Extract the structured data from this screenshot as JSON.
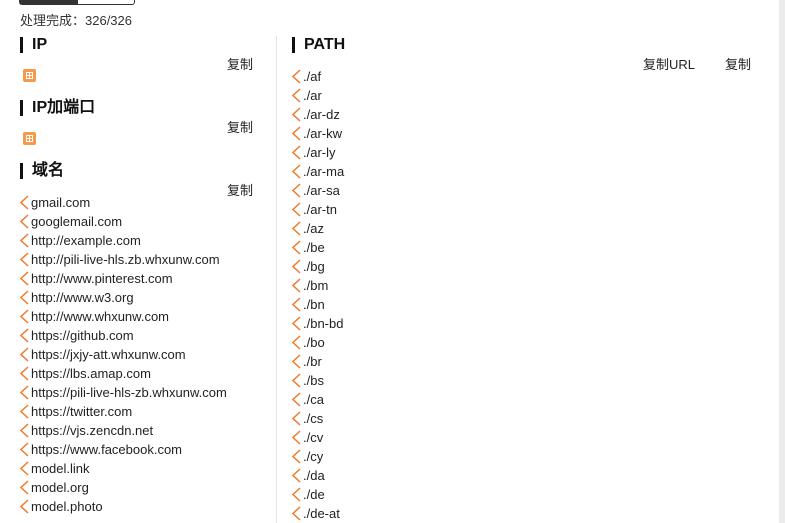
{
  "status": {
    "text": "处理完成：326/326"
  },
  "sections": {
    "ip": {
      "title": "IP",
      "copy_label": "复制"
    },
    "ip_port": {
      "title": "IP加端口",
      "copy_label": "复制"
    },
    "domain": {
      "title": "域名",
      "copy_label": "复制",
      "items": [
        "gmail.com",
        "googlemail.com",
        "http://example.com",
        "http://pili-live-hls.zb.whxunw.com",
        "http://www.pinterest.com",
        "http://www.w3.org",
        "http://www.whxunw.com",
        "https://github.com",
        "https://jxjy-att.whxunw.com",
        "https://lbs.amap.com",
        "https://pili-live-hls-zb.whxunw.com",
        "https://twitter.com",
        "https://vjs.zencdn.net",
        "https://www.facebook.com",
        "model.link",
        "model.org",
        "model.photo"
      ]
    },
    "path": {
      "title": "PATH",
      "copy_url_label": "复制URL",
      "copy_label": "复制",
      "items": [
        "./af",
        "./ar",
        "./ar-dz",
        "./ar-kw",
        "./ar-ly",
        "./ar-ma",
        "./ar-sa",
        "./ar-tn",
        "./az",
        "./be",
        "./bg",
        "./bm",
        "./bn",
        "./bn-bd",
        "./bo",
        "./br",
        "./bs",
        "./ca",
        "./cs",
        "./cv",
        "./cy",
        "./da",
        "./de",
        "./de-at"
      ]
    }
  },
  "colors": {
    "accent": "#f07a2a",
    "empty_icon": "#f59a4a",
    "text": "#222222"
  },
  "icons": {
    "list_marker": "chevron-left-icon",
    "empty": "empty-data-icon"
  }
}
